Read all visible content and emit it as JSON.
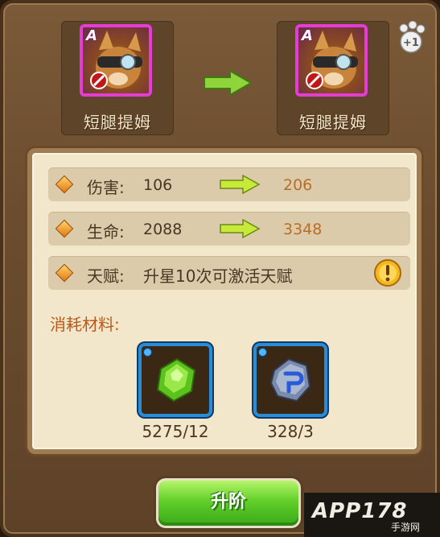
{
  "heroes": {
    "before": {
      "name": "短腿提姆",
      "rarity": "A"
    },
    "after": {
      "name": "短腿提姆",
      "rarity": "A"
    }
  },
  "star_bonus": "+1",
  "stats": [
    {
      "label": "伤害:",
      "current": "106",
      "next": "206"
    },
    {
      "label": "生命:",
      "current": "2088",
      "next": "3348"
    }
  ],
  "talent": {
    "label": "天赋:",
    "text": "升星10次可激活天赋"
  },
  "materials": {
    "title": "消耗材料:",
    "items": [
      {
        "icon": "green-gem-icon",
        "count": "5275/12"
      },
      {
        "icon": "blue-rune-stone-icon",
        "count": "328/3"
      }
    ]
  },
  "upgrade_button": "升阶",
  "watermark": {
    "main": "APP178",
    "sub": "手游网"
  },
  "colors": {
    "accent_green": "#62cf2a",
    "new_value": "#b86e24",
    "material_border": "#2b8cd6",
    "portrait_border": "#e43dd6"
  }
}
